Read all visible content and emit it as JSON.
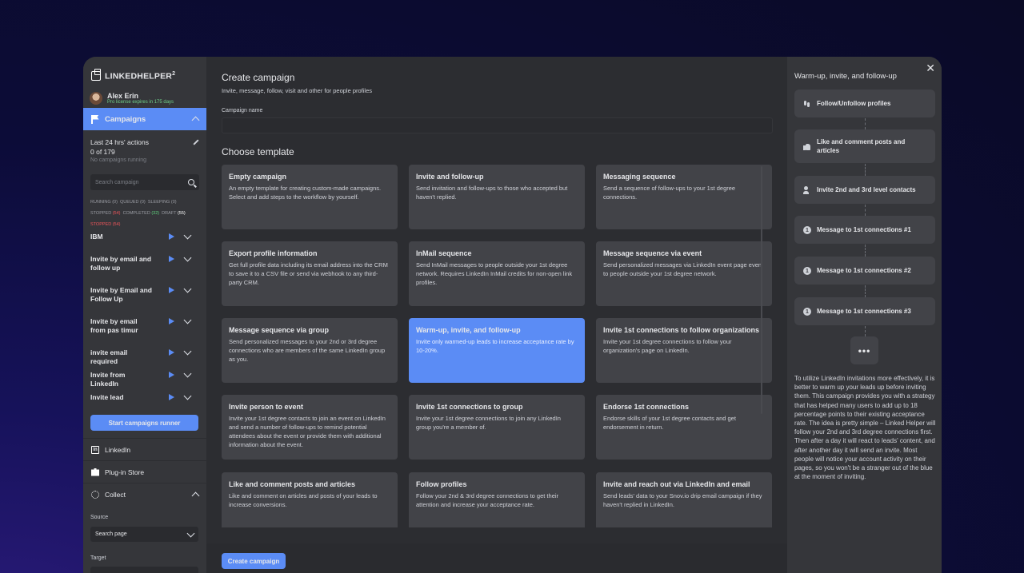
{
  "app": {
    "name": "LINKEDHELPER",
    "name_sup": "2"
  },
  "user": {
    "name": "Alex Erin",
    "license": "Pro license expires in 175 days"
  },
  "sidebar": {
    "campaigns_label": "Campaigns",
    "stats_title": "Last 24 hrs' actions",
    "stats_value": "0 of 179",
    "stats_sub": "No campaigns running",
    "search_placeholder": "Search campaign",
    "filters": {
      "running": "RUNNING (0)",
      "queued": "QUEUED (0)",
      "sleeping": "SLEEPING (0)",
      "stopped_label": "STOPPED",
      "stopped_count": "(54)",
      "completed_label": "COMPLETED",
      "completed_count": "(32)",
      "draft_label": "DRAFT",
      "draft_count": "(55)",
      "stopped_selected": "STOPPED (54)"
    },
    "campaigns": [
      {
        "name": "IBM"
      },
      {
        "name": "Invite by email and follow up"
      },
      {
        "name": "Invite by Email and Follow Up"
      },
      {
        "name": "Invite by email from pas timur"
      },
      {
        "name": "invite email required"
      },
      {
        "name": "Invite from LinkedIn"
      },
      {
        "name": "Invite lead"
      }
    ],
    "runner_button": "Start campaigns runner",
    "nav": {
      "linkedin": "LinkedIn",
      "plugin_store": "Plug-in Store",
      "collect": "Collect"
    },
    "source_label": "Source",
    "source_value": "Search page",
    "target_label": "Target"
  },
  "main": {
    "title": "Create campaign",
    "subtitle": "Invite, message, follow, visit and other for people profiles",
    "campaign_name_label": "Campaign name",
    "campaign_name_value": "",
    "templates_title": "Choose template",
    "templates": [
      {
        "title": "Empty campaign",
        "desc": "An empty template for creating custom-made campaigns. Select and add steps to the workflow by yourself.",
        "active": false
      },
      {
        "title": "Invite and follow-up",
        "desc": "Send invitation and follow-ups to those who accepted but haven't replied.",
        "active": false
      },
      {
        "title": "Messaging sequence",
        "desc": "Send a sequence of follow-ups to your 1st degree connections.",
        "active": false
      },
      {
        "title": "Export profile information",
        "desc": "Get full profile data including its email address into the CRM to save it to a CSV file or send via webhook to any third-party CRM.",
        "active": false
      },
      {
        "title": "InMail sequence",
        "desc": "Send InMail messages to people outside your 1st degree network. Requires LinkedIn InMail credits for non-open link profiles.",
        "active": false
      },
      {
        "title": "Message sequence via event",
        "desc": "Send personalized messages via LinkedIn event page even to people outside your 1st degree network.",
        "active": false
      },
      {
        "title": "Message sequence via group",
        "desc": "Send personalized messages to your 2nd or 3rd degree connections who are members of the same LinkedIn group as you.",
        "active": false
      },
      {
        "title": "Warm-up, invite, and follow-up",
        "desc": "Invite only warmed-up leads to increase acceptance rate by 10-20%.",
        "active": true
      },
      {
        "title": "Invite 1st connections to follow organizations",
        "desc": "Invite your 1st degree connections to follow your organization's page on LinkedIn.",
        "active": false
      },
      {
        "title": "Invite person to event",
        "desc": "Invite your 1st degree contacts to join an event on LinkedIn and send a number of follow-ups to remind potential attendees about the event or provide them with additional information about the event.",
        "active": false
      },
      {
        "title": "Invite 1st connections to group",
        "desc": "Invite your 1st degree connections to join any LinkedIn group you're a member of.",
        "active": false
      },
      {
        "title": "Endorse 1st connections",
        "desc": "Endorse skills of your 1st degree contacts and get endorsement in return.",
        "active": false
      },
      {
        "title": "Like and comment posts and articles",
        "desc": "Like and comment on articles and posts of your leads to increase conversions.",
        "active": false
      },
      {
        "title": "Follow profiles",
        "desc": "Follow your 2nd & 3rd degree connections to get their attention and increase your acceptance rate.",
        "active": false
      },
      {
        "title": "Invite and reach out via LinkedIn and email",
        "desc": "Send leads' data to your Snov.io drip email campaign if they haven't replied in LinkedIn.",
        "active": false
      }
    ],
    "create_button": "Create campaign"
  },
  "panel": {
    "title": "Warm-up, invite, and follow-up",
    "steps": [
      {
        "label": "Follow/Unfollow profiles",
        "icon": "footprint-icon"
      },
      {
        "label": "Like and comment posts and articles",
        "icon": "thumbs-up-icon"
      },
      {
        "label": "Invite 2nd and 3rd level contacts",
        "icon": "person-add-icon"
      },
      {
        "label": "Message to 1st connections #1",
        "icon": "message-icon"
      },
      {
        "label": "Message to 1st connections #2",
        "icon": "message-icon"
      },
      {
        "label": "Message to 1st connections #3",
        "icon": "message-icon"
      }
    ],
    "more": "•••",
    "description": "To utilize LinkedIn invitations more effectively, it is better to warm up your leads up before inviting them. This campaign provides you with a strategy that has helped many users to add up to 18 percentage points to their existing acceptance rate. The idea is pretty simple – Linked Helper will follow your 2nd and 3rd degree connections first. Then after a day it will react to leads' content, and after another day it will send an invite. Most people will notice your account activity on their pages, so you won't be a stranger out of the blue at the moment of inviting."
  }
}
